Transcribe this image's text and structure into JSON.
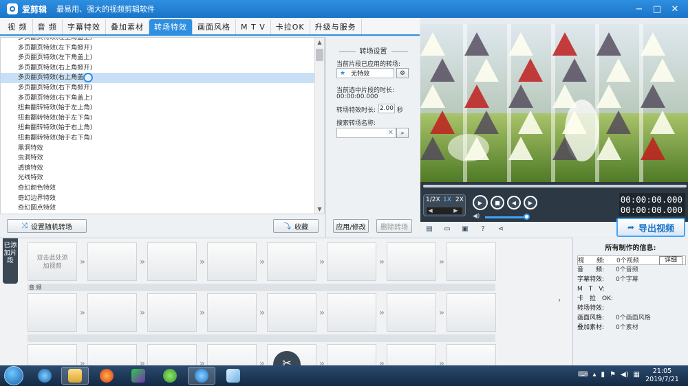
{
  "window": {
    "title": "爱剪辑",
    "slogan": "最易用、强大的视频剪辑软件",
    "controls": [
      "−",
      "□",
      "✕"
    ]
  },
  "tabs": [
    {
      "label": "视 频",
      "active": false
    },
    {
      "label": "音 频",
      "active": false
    },
    {
      "label": "字幕特效",
      "active": false
    },
    {
      "label": "叠加素材",
      "active": false
    },
    {
      "label": "转场特效",
      "active": true
    },
    {
      "label": "画面风格",
      "active": false
    },
    {
      "label": "M T V",
      "active": false
    },
    {
      "label": "卡拉OK",
      "active": false
    },
    {
      "label": "升级与服务",
      "active": false
    }
  ],
  "effects_list": {
    "items": [
      "多页翻页特效(左上角盖上)",
      "多页翻页特效(左下角掀开)",
      "多页翻页特效(左下角盖上)",
      "多页翻页特效(右上角掀开)",
      "多页翻页特效(右上角盖上)",
      "多页翻页特效(右下角掀开)",
      "多页翻页特效(右下角盖上)",
      "扭曲翻转特效(始于左上角)",
      "扭曲翻转特效(始于左下角)",
      "扭曲翻转特效(始于右上角)",
      "扭曲翻转特效(始于右下角)",
      "黑洞特效",
      "虫洞特效",
      "透镜特效",
      "光线特效",
      "奇幻颜色特效",
      "奇幻边界特效",
      "奇幻圆点特效"
    ],
    "selected_index": 4,
    "random_button": "设置随机转场",
    "collect_button": "收藏"
  },
  "transition_settings": {
    "title": "转场设置",
    "applied_label": "当前片段已应用的转场:",
    "applied_value": "无特效",
    "selected_time_label": "当前选中片段的时长:",
    "selected_time_value": "00:00:00.000",
    "duration_label": "转场特效时长:",
    "duration_value": "2.00",
    "duration_unit": "秒",
    "search_label": "搜索转场名称:",
    "search_value": "",
    "apply_button": "应用/修改",
    "delete_button": "删除转场"
  },
  "player": {
    "speeds": [
      "1/2X",
      "1X",
      "2X"
    ],
    "active_speed": "1X",
    "current_time": "00:00:00.000",
    "total_time": "00:00:00.000",
    "volume_fraction": 0.85,
    "export_button": "导出视频"
  },
  "timeline": {
    "side_tab": "已添加片段",
    "add_clip_text": "双击此处添加视频",
    "audio_label": "音 频"
  },
  "info_panel": {
    "title": "所有制作的信息:",
    "detail_button": "详细",
    "rows": [
      {
        "key": "视　　频:",
        "value": "0个视频"
      },
      {
        "key": "音　　频:",
        "value": "0个音频"
      },
      {
        "key": "字幕特效:",
        "value": "0个字幕"
      },
      {
        "key": "M　T　V:",
        "value": ""
      },
      {
        "key": "卡　拉　OK:",
        "value": ""
      },
      {
        "key": "转场特效:",
        "value": ""
      },
      {
        "key": "画面风格:",
        "value": "0个画面风格"
      },
      {
        "key": "叠加素材:",
        "value": "0个素材"
      }
    ]
  },
  "taskbar": {
    "time": "21:05",
    "date": "2019/7/21"
  },
  "colors": {
    "accent": "#2f8fe0",
    "titlebar": "#1a74c8",
    "player_bg": "#2c3844"
  }
}
